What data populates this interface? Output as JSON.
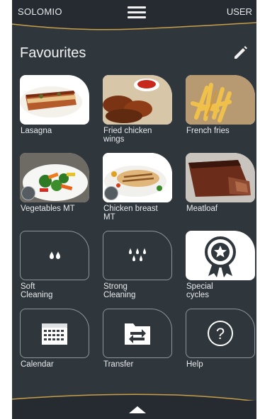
{
  "header": {
    "brand": "SOLOMIO",
    "user": "USER"
  },
  "page": {
    "title": "Favourites"
  },
  "tiles": [
    {
      "label": "Lasagna",
      "icon": "lasagna-photo"
    },
    {
      "label": "Fried chicken\nwings",
      "icon": "chicken-wings-photo"
    },
    {
      "label": "French fries",
      "icon": "french-fries-photo"
    },
    {
      "label": "Vegetables MT",
      "icon": "vegetables-photo"
    },
    {
      "label": "Chicken breast\nMT",
      "icon": "chicken-breast-photo"
    },
    {
      "label": "Meatloaf",
      "icon": "meatloaf-photo"
    },
    {
      "label": "Soft\nCleaning",
      "icon": "soft-drops-icon"
    },
    {
      "label": "Strong\nCleaning",
      "icon": "strong-drops-icon"
    },
    {
      "label": "Special\ncycles",
      "icon": "award-ribbon-icon"
    },
    {
      "label": "Calendar",
      "icon": "calendar-icon"
    },
    {
      "label": "Transfer",
      "icon": "folder-transfer-icon"
    },
    {
      "label": "Help",
      "icon": "help-icon"
    }
  ],
  "colors": {
    "background": "#2f363c",
    "bar": "#252b30",
    "accent_wave": "#c9a04a"
  }
}
